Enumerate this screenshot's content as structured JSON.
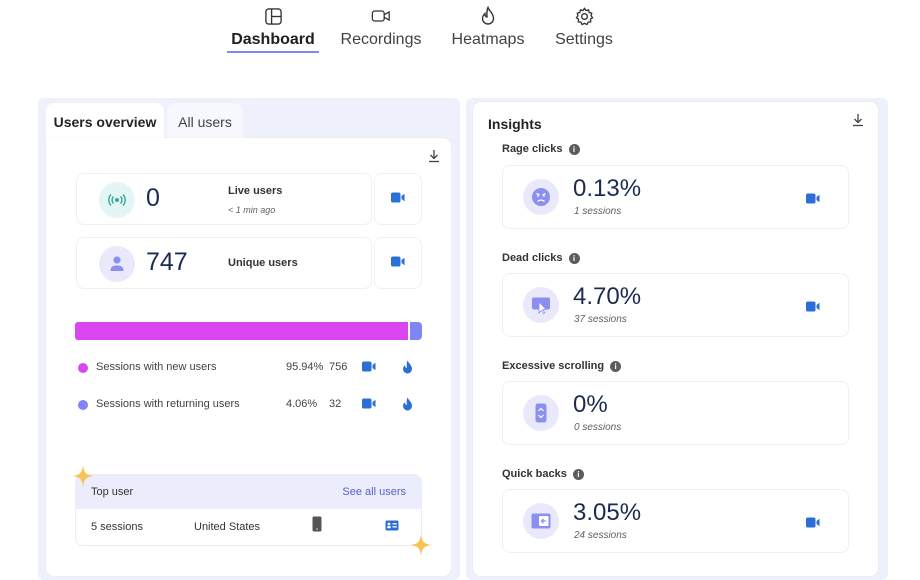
{
  "nav": {
    "items": [
      {
        "label": "Dashboard",
        "icon": "dashboard-icon",
        "active": true
      },
      {
        "label": "Recordings",
        "icon": "video-icon",
        "active": false
      },
      {
        "label": "Heatmaps",
        "icon": "fire-icon",
        "active": false
      },
      {
        "label": "Settings",
        "icon": "gear-icon",
        "active": false
      }
    ]
  },
  "left_panel": {
    "tabs": [
      {
        "label": "Users overview",
        "active": true
      },
      {
        "label": "All users",
        "active": false
      }
    ],
    "download_icon": "download-icon",
    "live_users": {
      "value": "0",
      "label": "Live users",
      "sub": "< 1 min ago",
      "icon": "live-signal-icon"
    },
    "unique_users": {
      "value": "747",
      "label": "Unique users",
      "icon": "user-icon"
    },
    "sessions_split": {
      "new_fraction": 0.9594,
      "returning_fraction": 0.0406,
      "rows": [
        {
          "label": "Sessions with new users",
          "percent": "95.94%",
          "count": "756",
          "color": "#d946ef"
        },
        {
          "label": "Sessions with returning users",
          "percent": "4.06%",
          "count": "32",
          "color": "#7f85f5"
        }
      ]
    },
    "top_user": {
      "title": "Top user",
      "link": "See all users",
      "sessions": "5 sessions",
      "country": "United States",
      "device_icon": "mobile-phone-icon",
      "details_icon": "contact-card-icon"
    }
  },
  "insights": {
    "title": "Insights",
    "items": [
      {
        "label": "Rage clicks",
        "value": "0.13%",
        "sessions": "1 sessions",
        "icon": "angry-face-icon",
        "has_recording": true
      },
      {
        "label": "Dead clicks",
        "value": "4.70%",
        "sessions": "37 sessions",
        "icon": "dead-click-cursor-icon",
        "has_recording": true
      },
      {
        "label": "Excessive scrolling",
        "value": "0%",
        "sessions": "0 sessions",
        "icon": "scroll-icon",
        "has_recording": false
      },
      {
        "label": "Quick backs",
        "value": "3.05%",
        "sessions": "24 sessions",
        "icon": "quick-back-icon",
        "has_recording": true
      }
    ]
  },
  "colors": {
    "accent": "#7f85f5",
    "new_users": "#d946ef",
    "returning_users": "#7f85f5",
    "camera_blue": "#2b6fd6",
    "value_navy": "#1b2a4e",
    "sparkle": "#f6c453"
  }
}
